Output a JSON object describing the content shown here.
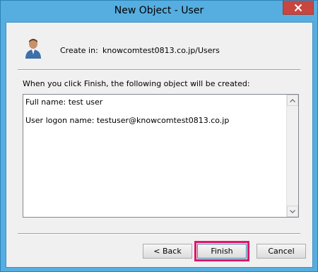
{
  "window": {
    "title": "New Object - User",
    "close_glyph": "✕"
  },
  "header": {
    "icon": "user-icon",
    "create_in_label": "Create in:",
    "create_in_path": "knowcomtest0813.co.jp/Users"
  },
  "description": "When you click Finish, the following object will be created:",
  "summary": {
    "full_name_line": "Full name: test user",
    "logon_line": "User logon name: testuser@knowcomtest0813.co.jp"
  },
  "buttons": {
    "back": "< Back",
    "finish": "Finish",
    "cancel": "Cancel"
  },
  "colors": {
    "highlight": "#e0156a",
    "titlebar": "#56aee0",
    "close": "#c7463f"
  }
}
